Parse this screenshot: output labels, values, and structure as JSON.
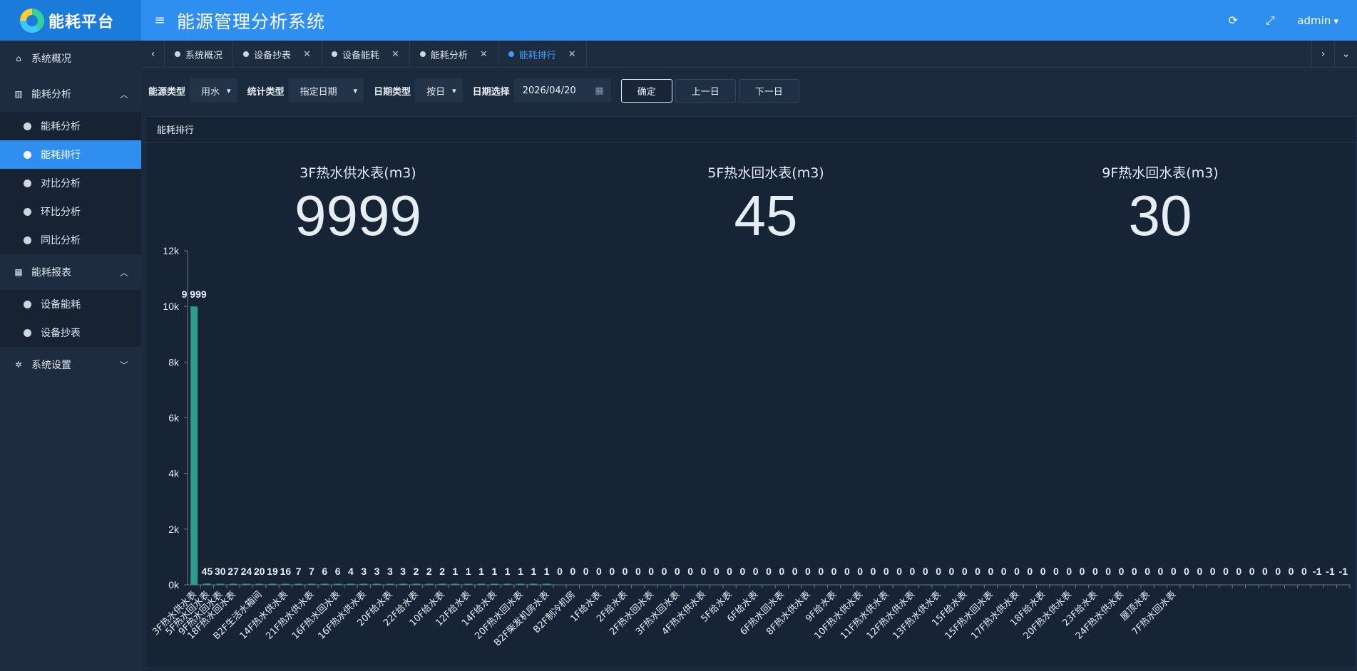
{
  "header": {
    "logo_text": "能耗平台",
    "title": "能源管理分析系统",
    "user": "admin",
    "icons": [
      "refresh-icon",
      "fullscreen-icon"
    ]
  },
  "sidebar": {
    "groups": [
      {
        "label": "系统概况",
        "icon": "home-icon",
        "items": []
      },
      {
        "label": "能耗分析",
        "icon": "bar-chart-icon",
        "expanded": true,
        "items": [
          {
            "label": "能耗分析"
          },
          {
            "label": "能耗排行",
            "active": true
          },
          {
            "label": "对比分析"
          },
          {
            "label": "环比分析"
          },
          {
            "label": "同比分析"
          }
        ]
      },
      {
        "label": "能耗报表",
        "icon": "table-icon",
        "expanded": true,
        "items": [
          {
            "label": "设备能耗"
          },
          {
            "label": "设备抄表"
          }
        ]
      },
      {
        "label": "系统设置",
        "icon": "gear-icon",
        "expanded": false,
        "items": []
      }
    ]
  },
  "tabs": [
    {
      "label": "系统概况",
      "closable": false
    },
    {
      "label": "设备抄表",
      "closable": true
    },
    {
      "label": "设备能耗",
      "closable": true
    },
    {
      "label": "能耗分析",
      "closable": true
    },
    {
      "label": "能耗排行",
      "closable": true,
      "active": true
    }
  ],
  "filters": {
    "energy_type_label": "能源类型",
    "energy_type_value": "用水",
    "stat_type_label": "统计类型",
    "stat_type_value": "指定日期",
    "date_type_label": "日期类型",
    "date_type_value": "按日",
    "date_select_label": "日期选择",
    "date_value": "2026/04/20",
    "confirm_label": "确定",
    "prev_label": "上一日",
    "next_label": "下一日"
  },
  "panel": {
    "title": "能耗排行",
    "stats": [
      {
        "title": "3F热水供水表(m3)",
        "value": "9999"
      },
      {
        "title": "5F热水回水表(m3)",
        "value": "45"
      },
      {
        "title": "9F热水回水表(m3)",
        "value": "30"
      }
    ]
  },
  "chart_data": {
    "type": "bar",
    "ylim": [
      0,
      12000
    ],
    "yticks": [
      "0k",
      "2k",
      "4k",
      "6k",
      "8k",
      "10k",
      "12k"
    ],
    "bar_color": "#2a9d8f",
    "categories": [
      "3F热水供水表",
      "5F热水回水表",
      "9F热水回水表",
      "18F热水回水表",
      "",
      "B2F生活水箱间",
      "",
      "14F热水供水表",
      "",
      "21F热水供水表",
      "",
      "16F热水回水表",
      "",
      "16F热水供水表",
      "",
      "20F给水表",
      "",
      "22F给水表",
      "",
      "10F给水表",
      "",
      "12F给水表",
      "",
      "14F给水表",
      "",
      "20F热水回水表",
      "",
      "B2F柴发机房水表",
      "",
      "B2F制冷机房",
      "",
      "1F给水表",
      "",
      "2F给水表",
      "",
      "2F热水回水表",
      "",
      "3F热水回水表",
      "",
      "4F热水供水表",
      "",
      "5F给水表",
      "",
      "6F给水表",
      "",
      "6F热水回水表",
      "",
      "8F热水供水表",
      "",
      "9F给水表",
      "",
      "10F热水供水表",
      "",
      "11F热水供水表",
      "",
      "12F热水供水表",
      "",
      "13F热水供水表",
      "",
      "15F给水表",
      "",
      "15F热水回水表",
      "",
      "17F热水供水表",
      "",
      "18F给水表",
      "",
      "20F热水供水表",
      "",
      "23F给水表",
      "",
      "24F热水供水表",
      "",
      "屋顶水表",
      "",
      "7F热水回水表"
    ],
    "values": [
      9999,
      45,
      30,
      27,
      24,
      20,
      19,
      16,
      7,
      7,
      6,
      6,
      4,
      3,
      3,
      3,
      3,
      2,
      2,
      2,
      1,
      1,
      1,
      1,
      1,
      1,
      1,
      1,
      0,
      0,
      0,
      0,
      0,
      0,
      0,
      0,
      0,
      0,
      0,
      0,
      0,
      0,
      0,
      0,
      0,
      0,
      0,
      0,
      0,
      0,
      0,
      0,
      0,
      0,
      0,
      0,
      0,
      0,
      0,
      0,
      0,
      0,
      0,
      0,
      0,
      0,
      0,
      0,
      0,
      0,
      0,
      0,
      0,
      0,
      0,
      0,
      0,
      0,
      0,
      0,
      0,
      0,
      0,
      0,
      0,
      0,
      -1,
      -1,
      -1
    ],
    "data_labels": [
      "9 999",
      "45",
      "30",
      "27",
      "24",
      "20",
      "19",
      "16",
      "7",
      "7",
      "6",
      "6",
      "4",
      "3",
      "3",
      "3",
      "3",
      "2",
      "2",
      "2",
      "1",
      "1",
      "1",
      "1",
      "1",
      "1",
      "1",
      "1",
      "0",
      "0",
      "0",
      "0",
      "0",
      "0",
      "0",
      "0",
      "0",
      "0",
      "0",
      "0",
      "0",
      "0",
      "0",
      "0",
      "0",
      "0",
      "0",
      "0",
      "0",
      "0",
      "0",
      "0",
      "0",
      "0",
      "0",
      "0",
      "0",
      "0",
      "0",
      "0",
      "0",
      "0",
      "0",
      "0",
      "0",
      "0",
      "0",
      "0",
      "0",
      "0",
      "0",
      "0",
      "0",
      "0",
      "0",
      "0",
      "0",
      "0",
      "0",
      "0",
      "0",
      "0",
      "0",
      "0",
      "0",
      "0",
      "-1",
      "-1",
      "-1"
    ]
  }
}
